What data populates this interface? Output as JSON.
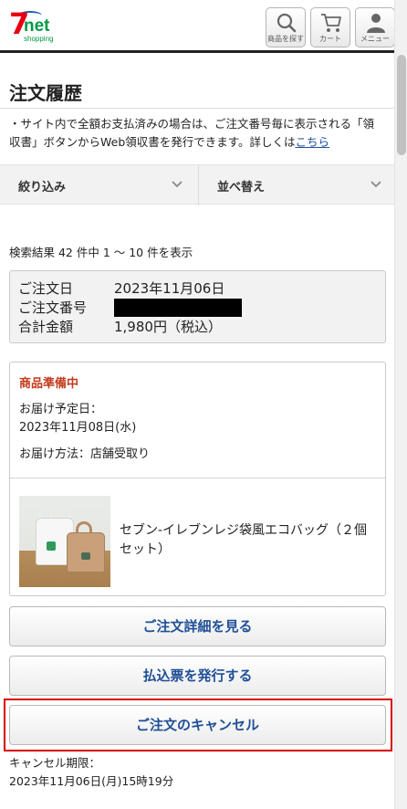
{
  "header": {
    "logo_seven": "7",
    "logo_net": "net",
    "logo_shopping": "shopping",
    "search_label": "商品を探す",
    "cart_label": "カート",
    "menu_label": "メニュー"
  },
  "page": {
    "title": "注文履歴",
    "notice_text": "・サイト内で全額お支払済みの場合は、ご注文番号毎に表示される「領収書」ボタンからWeb領収書を発行できます。詳しくは",
    "notice_link": "こちら"
  },
  "filters": {
    "filter_label": "絞り込み",
    "sort_label": "並べ替え"
  },
  "results": {
    "count_text": "検索結果 42 件中 1 ～ 10 件を表示"
  },
  "order": {
    "date_key": "ご注文日",
    "date_value": "2023年11月06日",
    "number_key": "ご注文番号",
    "total_key": "合計金額",
    "total_value": "1,980円（税込）",
    "status": "商品準備中",
    "delivery_date_label": "お届け予定日：",
    "delivery_date_value": "2023年11月08日(水)",
    "delivery_method": "お届け方法：店舗受取り",
    "product_name": "セブン-イレブンレジ袋風エコバッグ（２個セット）"
  },
  "actions": {
    "detail": "ご注文詳細を見る",
    "payment_slip": "払込票を発行する",
    "cancel": "ご注文のキャンセル"
  },
  "cancel_deadline": {
    "label": "キャンセル期限：",
    "value": "2023年11月06日(月)15時19分"
  },
  "colors": {
    "accent_blue": "#1f4f96",
    "status_red": "#c23a1a",
    "highlight_red": "#d40000"
  }
}
